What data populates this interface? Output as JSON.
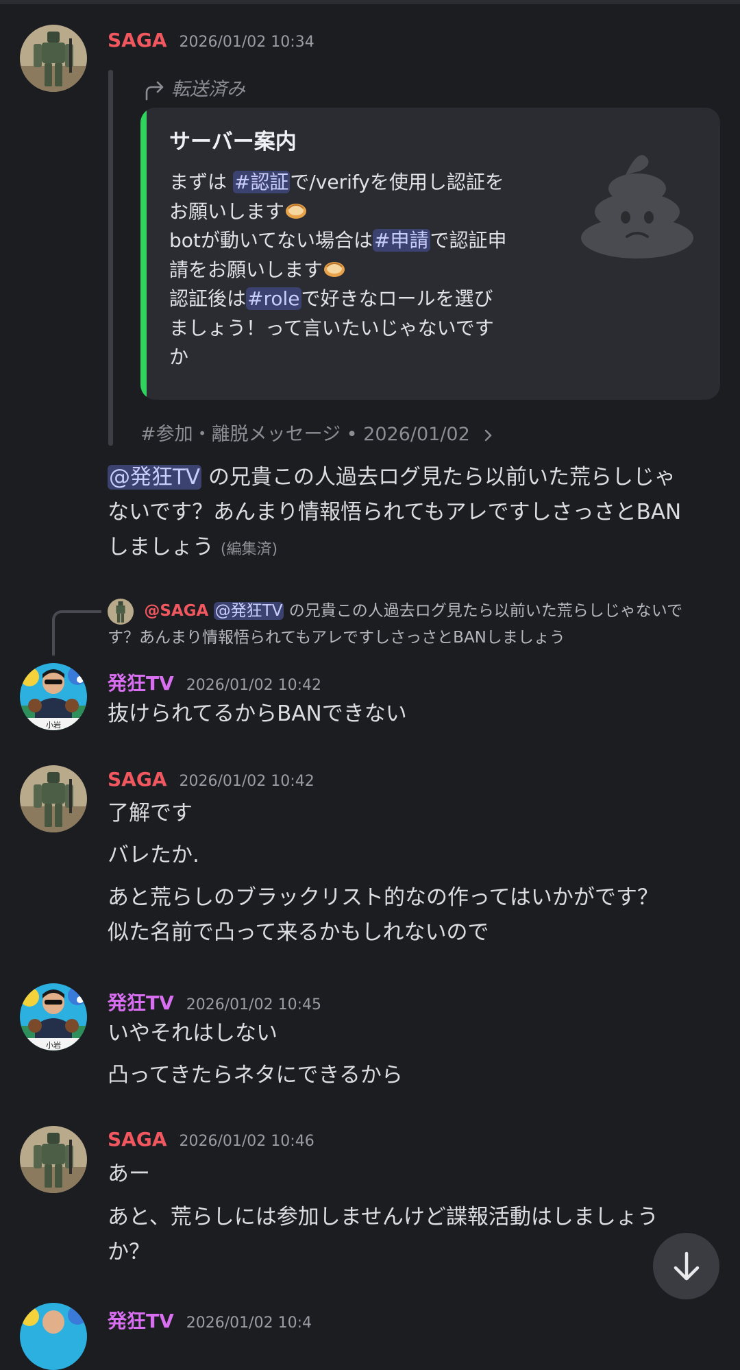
{
  "colors": {
    "background": "#1c1d21",
    "saga_name": "#f0575e",
    "hakkyou_name": "#d86ef0",
    "mention_bg": "#3c4270",
    "embed_accent": "#2fd35e"
  },
  "messages": [
    {
      "author": "SAGA",
      "timestamp": "2026/01/02 10:34",
      "forwarded": {
        "label": "転送済み",
        "embed": {
          "title": "サーバー案内",
          "lines": [
            {
              "before": "まずは ",
              "channel": "#認証",
              "after": "で/verifyを使用し認証を"
            },
            {
              "before": "お願いします",
              "emoji": "oyster-emoji"
            },
            {
              "before": "botが動いてない場合は",
              "channel": "#申請",
              "after": "で認証申"
            },
            {
              "before": "請をお願いします",
              "emoji": "oyster-emoji"
            },
            {
              "before": "認証後は",
              "channel": "#role",
              "after": "で好きなロールを選び"
            },
            {
              "before": "ましょう！って言いたいじゃないです"
            },
            {
              "before": "か"
            }
          ],
          "thumbnail_icon": "poop-icon"
        },
        "footer": "#参加・離脱メッセージ • 2026/01/02",
        "footer_icon": "chevron-right-icon"
      },
      "body": {
        "mention": "@発狂TV",
        "line1": " の兄貴この人過去ログ見たら以前いた荒らしじゃ",
        "line2": "ないです？あんまり情報悟られてもアレですしさっさとBAN",
        "line3": "しましょう",
        "edited": "(編集済)"
      }
    },
    {
      "reply": {
        "author": "@SAGA",
        "mention": "@発狂TV",
        "line1": " の兄貴この人過去ログ見たら以前いた荒らしじゃないで",
        "line2": "す？あんまり情報悟られてもアレですしさっさとBANしましょう"
      },
      "author": "発狂TV",
      "timestamp": "2026/01/02 10:42",
      "lines": [
        "抜けられてるからBANできない"
      ]
    },
    {
      "author": "SAGA",
      "timestamp": "2026/01/02 10:42",
      "lines": [
        "了解です",
        "バレたか.",
        "あと荒らしのブラックリスト的なの作ってはいかがです？",
        "似た名前で凸って来るかもしれないので"
      ]
    },
    {
      "author": "発狂TV",
      "timestamp": "2026/01/02 10:45",
      "lines": [
        "いやそれはしない",
        "凸ってきたらネタにできるから"
      ]
    },
    {
      "author": "SAGA",
      "timestamp": "2026/01/02 10:46",
      "lines": [
        "あー",
        "あと、荒らしには参加しませんけど諜報活動はしましょう",
        "か？"
      ]
    },
    {
      "author": "発狂TV",
      "timestamp": "2026/01/02 10:4"
    }
  ],
  "scroll_button_icon": "arrow-down-icon"
}
